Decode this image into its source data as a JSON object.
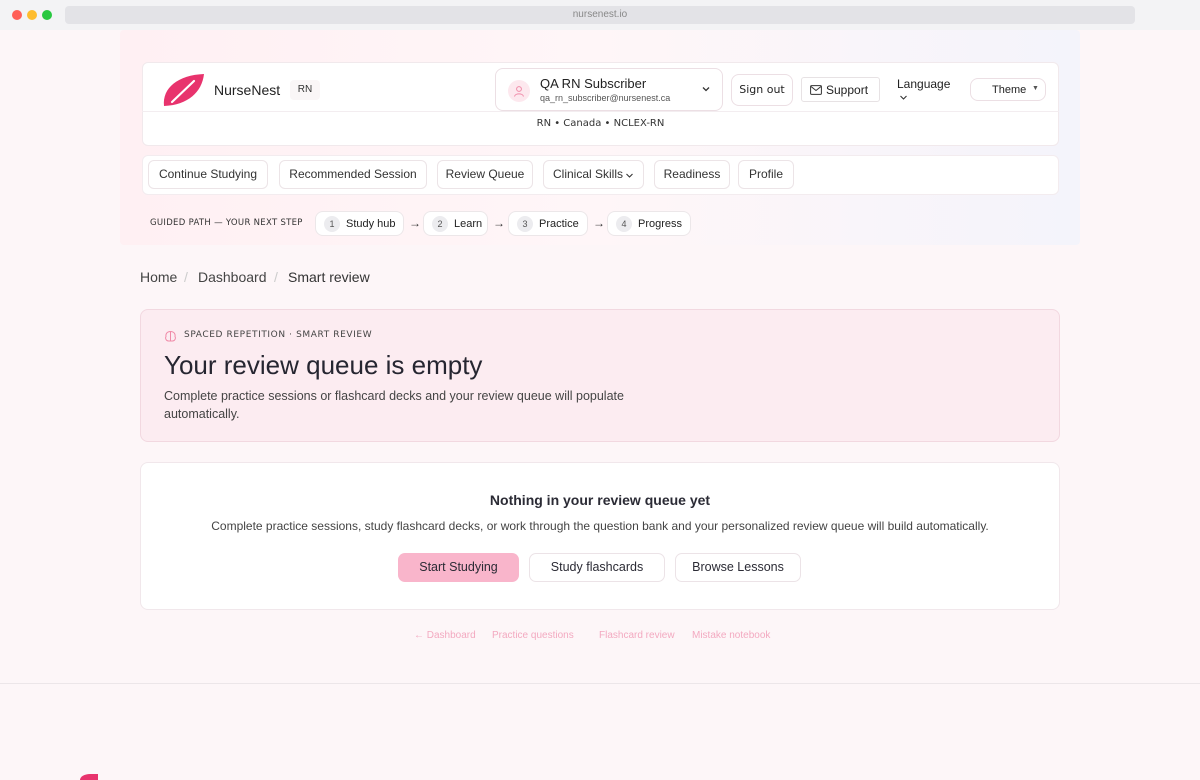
{
  "browser": {
    "url": "nursenest.io"
  },
  "header": {
    "brand": "NurseNest",
    "brand_badge": "RN",
    "user": {
      "name": "QA RN Subscriber",
      "email": "qa_rn_subscriber@nursenest.ca"
    },
    "sign_out": "Sign out",
    "support": "Support",
    "language": "Language",
    "theme": "Theme",
    "region": "RN • Canada • NCLEX-RN"
  },
  "nav": {
    "items": [
      "Continue Studying",
      "Recommended Session",
      "Review Queue",
      "Clinical Skills",
      "Readiness",
      "Profile"
    ]
  },
  "guided_path": {
    "label": "GUIDED PATH — YOUR NEXT STEP",
    "steps": [
      {
        "num": "1",
        "label": "Study hub"
      },
      {
        "num": "2",
        "label": "Learn"
      },
      {
        "num": "3",
        "label": "Practice"
      },
      {
        "num": "4",
        "label": "Progress"
      }
    ],
    "arrow": "→"
  },
  "breadcrumb": {
    "items": [
      "Home",
      "Dashboard",
      "Smart review"
    ],
    "sep": "/"
  },
  "hero": {
    "eyebrow": "SPACED REPETITION · SMART REVIEW",
    "title": "Your review queue is empty",
    "description": "Complete practice sessions or flashcard decks and your review queue will populate automatically."
  },
  "empty_state": {
    "title": "Nothing in your review queue yet",
    "description": "Complete practice sessions, study flashcard decks, or work through the question bank and your personalized review queue will build automatically.",
    "primary": "Start Studying",
    "secondary1": "Study flashcards",
    "secondary2": "Browse Lessons"
  },
  "footer_links": [
    "← Dashboard",
    "Practice questions",
    "Flashcard review",
    "Mistake notebook"
  ],
  "colors": {
    "accent": "#e8336d",
    "primary_button": "#f9b5cb",
    "hero_bg": "#fcecf1",
    "link": "#f3a9c0"
  }
}
